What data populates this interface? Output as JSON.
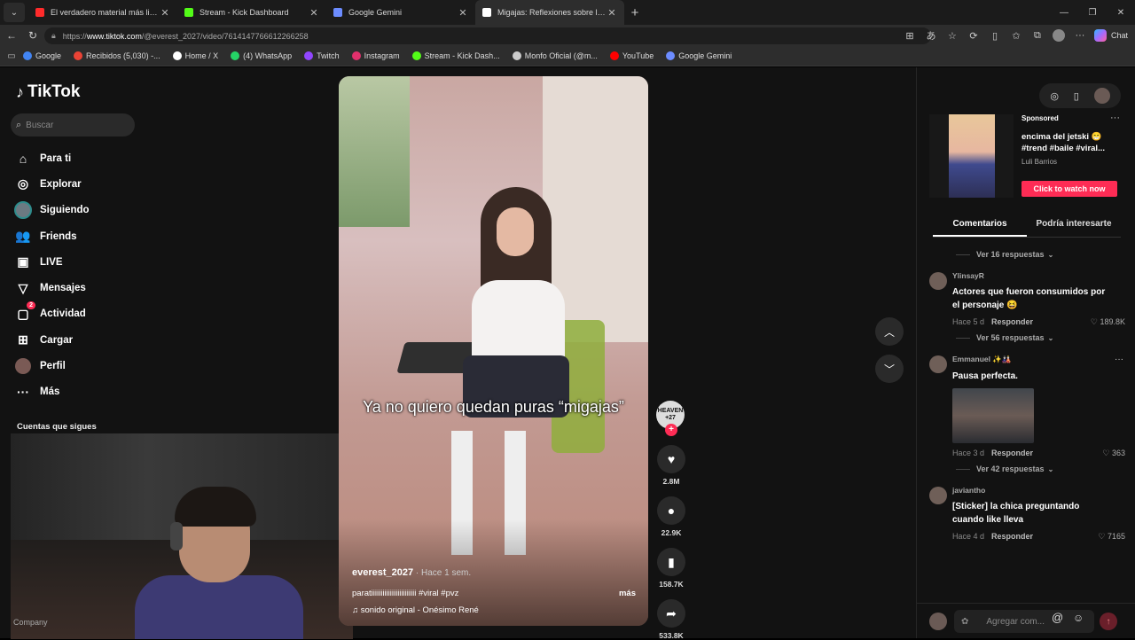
{
  "browser": {
    "tabs": [
      {
        "title": "El verdadero material más ligero d",
        "color": "#ff2b2b",
        "active": false
      },
      {
        "title": "Stream - Kick Dashboard",
        "color": "#53fc18",
        "active": false
      },
      {
        "title": "Google Gemini",
        "color": "#6c8cff",
        "active": false
      },
      {
        "title": "Migajas: Reflexiones sobre lo que",
        "color": "#ffffff",
        "active": true
      }
    ],
    "url_prefix": "https://",
    "url_domain": "www.tiktok.com",
    "url_path": "/@everest_2027/video/7614147766612266258",
    "chat_label": "Chat",
    "bookmarks": [
      {
        "label": "Google",
        "color": "#4285f4"
      },
      {
        "label": "Recibidos (5,030) -...",
        "color": "#ea4335"
      },
      {
        "label": "Home / X",
        "color": "#ffffff"
      },
      {
        "label": "(4) WhatsApp",
        "color": "#25d366"
      },
      {
        "label": "Twitch",
        "color": "#9146ff"
      },
      {
        "label": "Instagram",
        "color": "#e1306c"
      },
      {
        "label": "Stream - Kick Dash...",
        "color": "#53fc18"
      },
      {
        "label": "Monfo Oficial (@m...",
        "color": "#cccccc"
      },
      {
        "label": "YouTube",
        "color": "#ff0000"
      },
      {
        "label": "Google Gemini",
        "color": "#6c8cff"
      }
    ]
  },
  "sidebar": {
    "logo": "TikTok",
    "search_placeholder": "Buscar",
    "items": [
      {
        "label": "Para ti",
        "icon": "home-icon",
        "glyph": "⌂"
      },
      {
        "label": "Explorar",
        "icon": "compass-icon",
        "glyph": "◎"
      },
      {
        "label": "Siguiendo",
        "icon": "following-avatar",
        "glyph": ""
      },
      {
        "label": "Friends",
        "icon": "friends-icon",
        "glyph": "👥"
      },
      {
        "label": "LIVE",
        "icon": "live-icon",
        "glyph": "▣"
      },
      {
        "label": "Mensajes",
        "icon": "messages-icon",
        "glyph": "▽"
      },
      {
        "label": "Actividad",
        "icon": "activity-icon",
        "glyph": "▢",
        "badge": "2"
      },
      {
        "label": "Cargar",
        "icon": "upload-icon",
        "glyph": "⊞"
      },
      {
        "label": "Perfil",
        "icon": "profile-avatar",
        "glyph": ""
      },
      {
        "label": "Más",
        "icon": "more-icon",
        "glyph": "···"
      }
    ],
    "following_title": "Cuentas que sigues",
    "webcam_label": "Company"
  },
  "video": {
    "overlay_text": "Ya no quiero quedan puras “migajas”",
    "username": "everest_2027",
    "posted": " · Hace 1 sem.",
    "description": "paratiiiiiiiiiiiiiiiiiiiiiiii #viral #pvz",
    "more": "más",
    "sound": "♫ sonido original - Onésimo René",
    "avatar_text": "HEAVEN +27",
    "likes": "2.8M",
    "comments": "22.9K",
    "saves": "158.7K",
    "shares": "533.8K"
  },
  "right": {
    "ad": {
      "sponsored": "Sponsored",
      "title": "encima del jetski 😁 #trend #baile #viral...",
      "author": "Luli Barrios",
      "cta": "Click to watch now"
    },
    "tabs": [
      "Comentarios",
      "Podría interesarte"
    ],
    "comments": [
      {
        "replies_before": "Ver 16 respuestas"
      },
      {
        "user": "YlinsayR",
        "text": "Actores que fueron consumidos por el personaje 😆",
        "time": "Hace 5 d",
        "reply": "Responder",
        "likes": "♡ 189.8K"
      },
      {
        "replies_before": "Ver 56 respuestas"
      },
      {
        "user": "Emmanuel ✨🎎",
        "text": "Pausa perfecta.",
        "time": "Hace 3 d",
        "reply": "Responder",
        "likes": "♡ 363",
        "image": true
      },
      {
        "replies_before": "Ver 42 respuestas"
      },
      {
        "user": "javiantho",
        "text": "[Sticker] la chica preguntando cuando like lleva",
        "time": "Hace 4 d",
        "reply": "Responder",
        "likes": "♡ 7165"
      }
    ],
    "input_placeholder": "Agregar com..."
  }
}
